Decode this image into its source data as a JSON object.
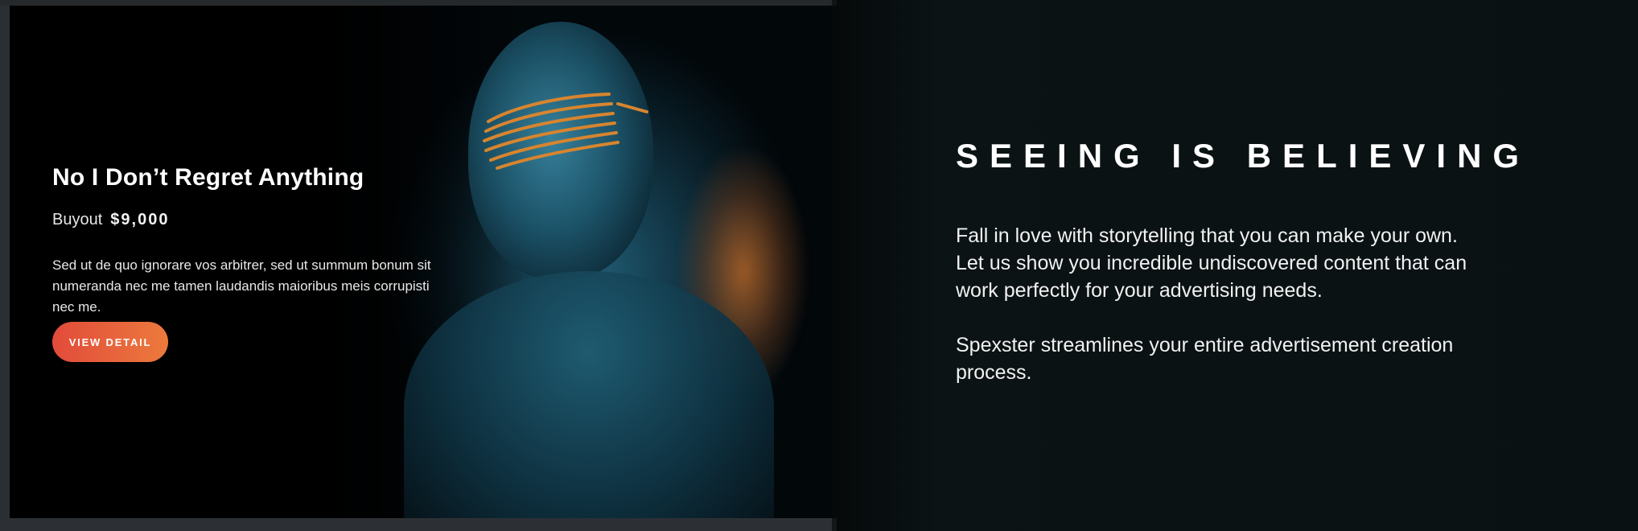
{
  "card": {
    "title": "No I Don’t Regret Anything",
    "price_label": "Buyout",
    "price_value": "$9,000",
    "description": "Sed ut de quo ignorare vos arbitrer, sed ut summum bonum sit numeranda nec me tamen laudandis maioribus meis corrupisti nec me.",
    "button_label": "VIEW DETAIL"
  },
  "content": {
    "heading": "SEEING IS BELIEVING",
    "paragraph_1": "Fall in love with storytelling that you can make your own. Let us show you incredible undiscovered content that can work perfectly for your advertising needs.",
    "paragraph_2": "Spexster streamlines your entire advertisement creation process."
  },
  "colors": {
    "page_background": "#0b1214",
    "button_gradient_start": "#e24b3b",
    "button_gradient_end": "#ec7a3c",
    "text_primary": "#ffffff"
  }
}
